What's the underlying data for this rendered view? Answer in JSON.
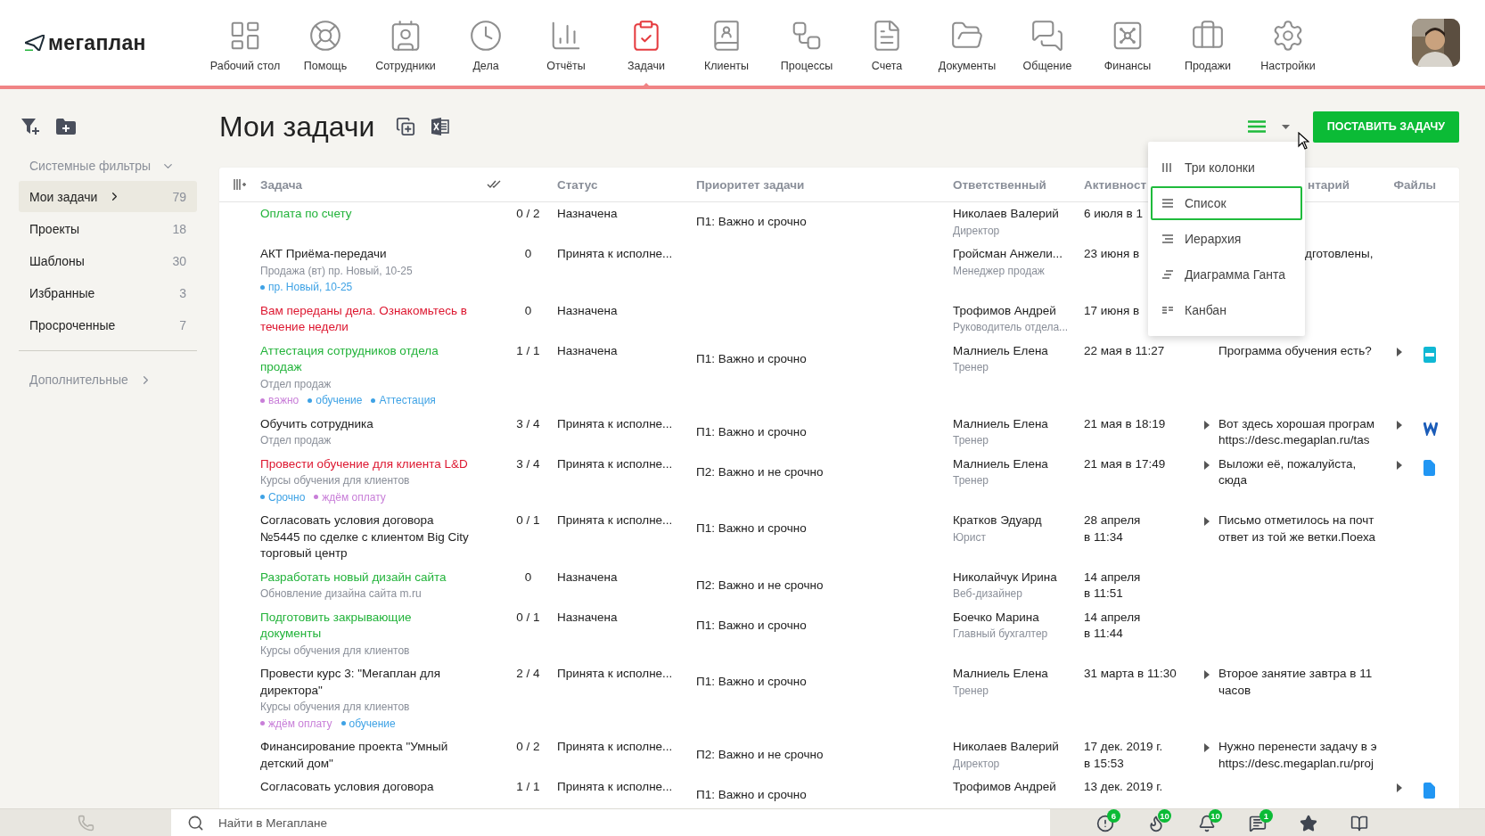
{
  "brand": {
    "name": "мегаплан"
  },
  "nav": [
    {
      "label": "Рабочий стол",
      "selected": false
    },
    {
      "label": "Помощь",
      "selected": false
    },
    {
      "label": "Сотрудники",
      "selected": false
    },
    {
      "label": "Дела",
      "selected": false
    },
    {
      "label": "Отчёты",
      "selected": false
    },
    {
      "label": "Задачи",
      "selected": true
    },
    {
      "label": "Клиенты",
      "selected": false
    },
    {
      "label": "Процессы",
      "selected": false
    },
    {
      "label": "Счета",
      "selected": false
    },
    {
      "label": "Документы",
      "selected": false
    },
    {
      "label": "Общение",
      "selected": false
    },
    {
      "label": "Финансы",
      "selected": false
    },
    {
      "label": "Продажи",
      "selected": false
    },
    {
      "label": "Настройки",
      "selected": false
    }
  ],
  "sidebar": {
    "section": {
      "label": "Системные фильтры",
      "expanded": true
    },
    "items": [
      {
        "label": "Мои задачи",
        "count": "79",
        "selected": true
      },
      {
        "label": "Проекты",
        "count": "18",
        "selected": false
      },
      {
        "label": "Шаблоны",
        "count": "30",
        "selected": false
      },
      {
        "label": "Избранные",
        "count": "3",
        "selected": false
      },
      {
        "label": "Просроченные",
        "count": "7",
        "selected": false
      }
    ],
    "extra": {
      "label": "Дополнительные",
      "expanded": false
    }
  },
  "page": {
    "title": "Мои задачи",
    "primary_button": "ПОСТАВИТЬ ЗАДАЧУ"
  },
  "view_menu": [
    {
      "label": "Три колонки",
      "selected": false
    },
    {
      "label": "Список",
      "selected": true
    },
    {
      "label": "Иерархия",
      "selected": false
    },
    {
      "label": "Диаграмма Ганта",
      "selected": false
    },
    {
      "label": "Канбан",
      "selected": false
    }
  ],
  "table": {
    "columns": [
      {
        "label": "Задача"
      },
      {
        "label": "Статус"
      },
      {
        "label": "Приоритет задачи"
      },
      {
        "label": "Ответственный"
      },
      {
        "label": "Активност"
      },
      {
        "label": "нтарий",
        "covered": true
      },
      {
        "label": "Файлы"
      }
    ],
    "rows": [
      {
        "title": "Оплата по счету",
        "color": "#22b33a",
        "count": "0 / 2",
        "status": "Назначена",
        "priority": "П1: Важно и срочно",
        "person": "Николаев Валерий",
        "role": "Директор",
        "activity": "6 июля в 1"
      },
      {
        "title": "АКТ Приёма-передачи",
        "color": "#222222",
        "sub": "Продажа (вт) пр. Новый, 10-25",
        "tags": [
          {
            "label": "пр. Новый, 10-25",
            "color": "#3ea2e5"
          }
        ],
        "count": "0",
        "status": "Принята к исполне...",
        "person": "Гройсман Анжели...",
        "role": "Менеджер продаж",
        "activity": "23 июня в",
        "comment": "дготовлены,",
        "comment_covered": true
      },
      {
        "title": "Вам переданы дела. Ознакомьтесь в\nтечение недели",
        "color": "#dd1730",
        "count": "0",
        "status": "Назначена",
        "person": "Трофимов Андрей",
        "role": "Руководитель отдела...",
        "activity": "17 июня в"
      },
      {
        "title": "Аттестация сотрудников отдела\nпродаж",
        "color": "#22b33a",
        "sub": "Отдел продаж",
        "tags": [
          {
            "label": "важно",
            "color": "#c87ed8"
          },
          {
            "label": "обучение",
            "color": "#3ea2e5"
          },
          {
            "label": "Аттестация",
            "color": "#3ea2e5"
          }
        ],
        "count": "1 / 1",
        "status": "Назначена",
        "priority": "П1: Важно и срочно",
        "person": "Малниель Елена",
        "role": "Тренер",
        "activity": "22 мая в 11:27",
        "comment": "Программа обучения есть?",
        "file_toggle": true,
        "file": {
          "kind": "pdf"
        }
      },
      {
        "title": "Обучить сотрудника",
        "color": "#222222",
        "sub": "Отдел продаж",
        "count": "3 / 4",
        "status": "Принята к исполне...",
        "priority": "П1: Важно и срочно",
        "person": "Малниель Елена",
        "role": "Тренер",
        "activity": "21 мая в 18:19",
        "comment_toggle": true,
        "comment": "Вот здесь хорошая програм\nhttps://desc.megaplan.ru/tas",
        "file_toggle": true,
        "file": {
          "kind": "word"
        }
      },
      {
        "title": "Провести обучение для клиента L&D",
        "color": "#dd1730",
        "sub": "Курсы обучения для клиентов",
        "tags": [
          {
            "label": "Срочно",
            "color": "#3ea2e5"
          },
          {
            "label": "ждём оплату",
            "color": "#c87ed8"
          }
        ],
        "count": "3 / 4",
        "status": "Принята к исполне...",
        "priority": "П2: Важно и не срочно",
        "person": "Малниель Елена",
        "role": "Тренер",
        "activity": "21 мая в 17:49",
        "comment_toggle": true,
        "comment": "Выложи её, пожалуйста,\nсюда",
        "file_toggle": true,
        "file": {
          "kind": "doc"
        }
      },
      {
        "title": "Согласовать условия договора\n№5445 по сделке с клиентом Big City\nторговый центр",
        "color": "#222222",
        "count": "0 / 1",
        "status": "Принята к исполне...",
        "priority": "П1: Важно и срочно",
        "person": "Кратков Эдуард",
        "role": "Юрист",
        "activity": "28 апреля\nв 11:34",
        "comment_toggle": true,
        "comment": "Письмо отметилось на почт\nответ из той же ветки.Поеха"
      },
      {
        "title": "Разработать новый дизайн сайта",
        "color": "#22b33a",
        "sub": "Обновление дизайна сайта m.ru",
        "count": "0",
        "status": "Назначена",
        "priority": "П2: Важно и не срочно",
        "person": "Николайчук Ирина",
        "role": "Веб-дизайнер",
        "activity": "14 апреля\nв 11:51"
      },
      {
        "title": "Подготовить закрывающие\nдокументы",
        "color": "#22b33a",
        "sub": "Курсы обучения для клиентов",
        "count": "0 / 1",
        "status": "Назначена",
        "priority": "П1: Важно и срочно",
        "person": "Боечко Марина",
        "role": "Главный бухгалтер",
        "activity": "14 апреля\nв 11:44"
      },
      {
        "title": "Провести курс 3: \"Мегаплан для\nдиректора\"",
        "color": "#222222",
        "sub": "Курсы обучения для клиентов",
        "tags": [
          {
            "label": "ждём оплату",
            "color": "#c87ed8"
          },
          {
            "label": "обучение",
            "color": "#3ea2e5"
          }
        ],
        "count": "2 / 4",
        "status": "Принята к исполне...",
        "priority": "П1: Важно и срочно",
        "person": "Малниель Елена",
        "role": "Тренер",
        "activity": "31 марта в 11:30",
        "comment_toggle": true,
        "comment": "Второе занятие завтра в 11\nчасов"
      },
      {
        "title": "Финансирование проекта \"Умный\nдетский дом\"",
        "color": "#222222",
        "count": "0 / 2",
        "status": "Принята к исполне...",
        "priority": "П2: Важно и не срочно",
        "person": "Николаев Валерий",
        "role": "Директор",
        "activity": "17 дек. 2019 г.\nв 15:53",
        "comment_toggle": true,
        "comment": "Нужно перенести задачу в э\nhttps://desc.megaplan.ru/proj"
      },
      {
        "title": "Согласовать условия договора",
        "color": "#222222",
        "count": "1 / 1",
        "status": "Принята к исполне...",
        "priority": "П1: Важно и срочно",
        "person": "Трофимов Андрей",
        "activity": "13 дек. 2019 г.",
        "file_toggle": true,
        "file": {
          "kind": "doc"
        }
      }
    ]
  },
  "bottom_bar": {
    "search": {
      "placeholder": "Найти в Мегаплане"
    },
    "badges": [
      "6",
      "10",
      "10",
      "1"
    ]
  }
}
